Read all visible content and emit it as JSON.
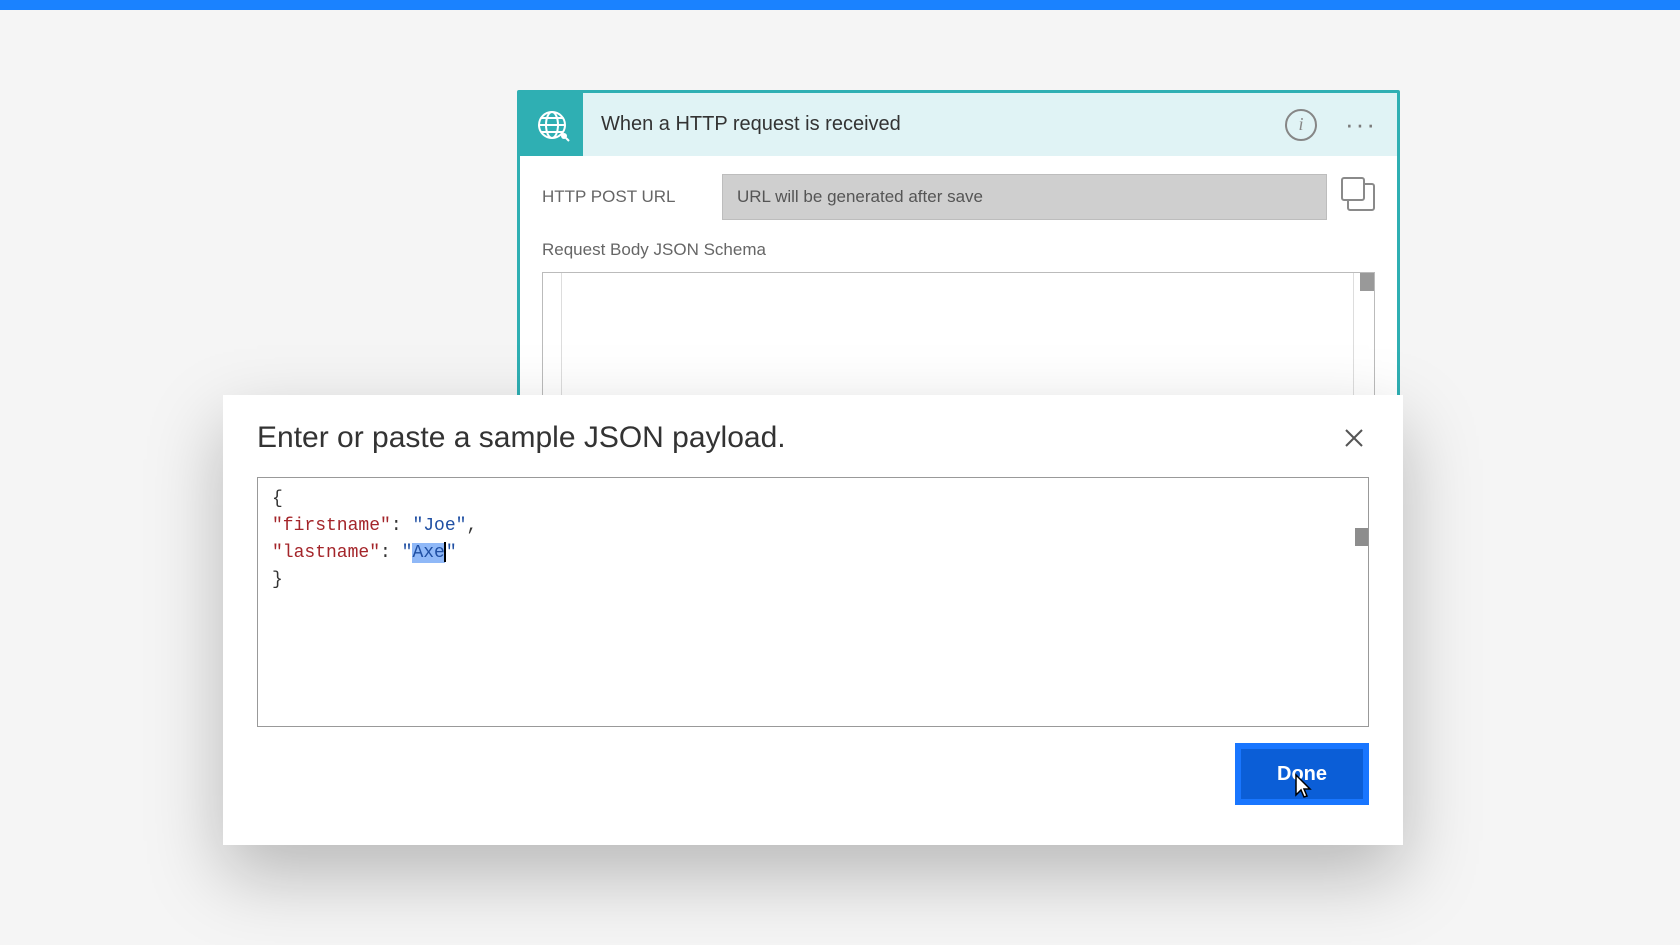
{
  "trigger": {
    "title": "When a HTTP request is received",
    "url_label": "HTTP POST URL",
    "url_placeholder": "URL will be generated after save",
    "schema_label": "Request Body JSON Schema"
  },
  "modal": {
    "title": "Enter or paste a sample JSON payload.",
    "done_label": "Done",
    "json": {
      "line1_open": "{",
      "line2_indent": "    ",
      "line2_key": "\"firstname\"",
      "line2_colon": ": ",
      "line2_val": "\"Joe\"",
      "line2_comma": ",",
      "line3_indent": "    ",
      "line3_key": "\"lastname\"",
      "line3_colon": ": ",
      "line3_val_openq": "\"",
      "line3_val_sel": "Axe",
      "line3_val_closeq": "\"",
      "line4_close": "}"
    }
  }
}
